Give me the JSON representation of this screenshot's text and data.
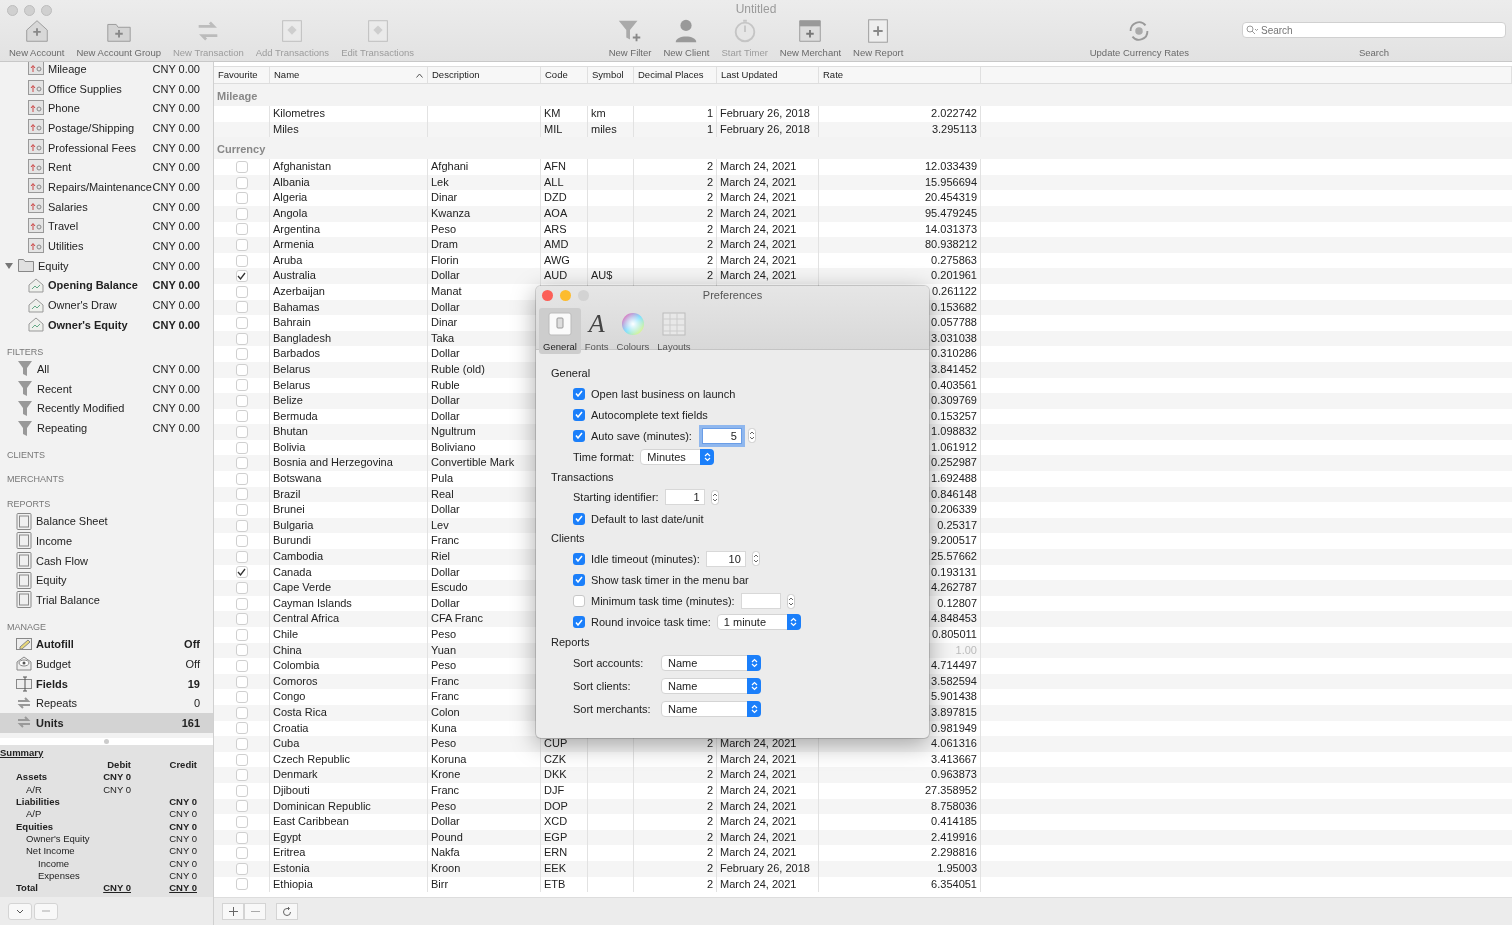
{
  "window": {
    "title": "Untitled"
  },
  "toolbar": {
    "items": [
      {
        "label": "New Account",
        "disabled": false
      },
      {
        "label": "New Account Group",
        "disabled": false
      },
      {
        "label": "New Transaction",
        "disabled": true
      },
      {
        "label": "Add Transactions",
        "disabled": true
      },
      {
        "label": "Edit Transactions",
        "disabled": true
      },
      {
        "label": "New Filter",
        "disabled": false
      },
      {
        "label": "New Client",
        "disabled": false
      },
      {
        "label": "Start Timer",
        "disabled": true
      },
      {
        "label": "New Merchant",
        "disabled": false
      },
      {
        "label": "New Report",
        "disabled": false
      },
      {
        "label": "Update Currency Rates",
        "disabled": false
      }
    ],
    "search": {
      "placeholder": "Search",
      "label": "Search"
    }
  },
  "sidebar": {
    "accounts": [
      {
        "name": "Mileage",
        "amount": "CNY 0.00",
        "emphasized": false
      },
      {
        "name": "Office Supplies",
        "amount": "CNY 0.00",
        "emphasized": false
      },
      {
        "name": "Phone",
        "amount": "CNY 0.00",
        "emphasized": false
      },
      {
        "name": "Postage/Shipping",
        "amount": "CNY 0.00",
        "emphasized": false
      },
      {
        "name": "Professional Fees",
        "amount": "CNY 0.00",
        "emphasized": false
      },
      {
        "name": "Rent",
        "amount": "CNY 0.00",
        "emphasized": false
      },
      {
        "name": "Repairs/Maintenance",
        "amount": "CNY 0.00",
        "emphasized": false
      },
      {
        "name": "Salaries",
        "amount": "CNY 0.00",
        "emphasized": false
      },
      {
        "name": "Travel",
        "amount": "CNY 0.00",
        "emphasized": false
      },
      {
        "name": "Utilities",
        "amount": "CNY 0.00",
        "emphasized": false
      },
      {
        "name": "Equity",
        "amount": "CNY 0.00",
        "emphasized": false,
        "expanded": true,
        "children": [
          {
            "name": "Opening Balance",
            "amount": "CNY 0.00",
            "emphasized": true
          },
          {
            "name": "Owner's Draw",
            "amount": "CNY 0.00",
            "emphasized": false
          },
          {
            "name": "Owner's Equity",
            "amount": "CNY 0.00",
            "emphasized": true
          }
        ]
      }
    ],
    "sections": [
      {
        "heading": "FILTERS",
        "kind": "filters",
        "items": [
          {
            "name": "All",
            "value": "CNY 0.00",
            "emphasized": false,
            "selected": false
          },
          {
            "name": "Recent",
            "value": "CNY 0.00",
            "emphasized": false,
            "selected": false
          },
          {
            "name": "Recently Modified",
            "value": "CNY 0.00",
            "emphasized": false,
            "selected": false
          },
          {
            "name": "Repeating",
            "value": "CNY 0.00",
            "emphasized": false,
            "selected": false
          }
        ]
      },
      {
        "heading": "CLIENTS",
        "kind": "clients"
      },
      {
        "heading": "MERCHANTS",
        "kind": "merchants"
      },
      {
        "heading": "REPORTS",
        "kind": "reports",
        "items": [
          {
            "name": "Balance Sheet",
            "emphasized": false,
            "selected": false
          },
          {
            "name": "Income",
            "emphasized": false,
            "selected": false
          },
          {
            "name": "Cash Flow",
            "emphasized": false,
            "selected": false
          },
          {
            "name": "Equity",
            "emphasized": false,
            "selected": false
          },
          {
            "name": "Trial Balance",
            "emphasized": false,
            "selected": false
          }
        ]
      },
      {
        "heading": "MANAGE",
        "kind": "manage",
        "items": [
          {
            "name": "Autofill",
            "value": "Off",
            "emphasized": true,
            "selected": false
          },
          {
            "name": "Budget",
            "value": "Off",
            "emphasized": false,
            "selected": false
          },
          {
            "name": "Fields",
            "value": "19",
            "emphasized": true,
            "selected": false
          },
          {
            "name": "Repeats",
            "value": "0",
            "emphasized": false,
            "selected": false
          },
          {
            "name": "Units",
            "value": "161",
            "emphasized": true,
            "selected": true
          }
        ]
      }
    ],
    "summary": {
      "title": "Summary",
      "debit_heading": "Debit",
      "credit_heading": "Credit",
      "rows": [
        {
          "label": "Assets",
          "kind": "group",
          "debit": "CNY 0",
          "children": [
            {
              "label": "A/R",
              "debit": "CNY 0"
            }
          ]
        },
        {
          "label": "Liabilities",
          "kind": "group",
          "credit": "CNY 0",
          "children": [
            {
              "label": "A/P",
              "credit": "CNY 0"
            }
          ]
        },
        {
          "label": "Equities",
          "kind": "group",
          "credit": "CNY 0",
          "children": [
            {
              "label": "Owner's Equity",
              "credit": "CNY 0"
            },
            {
              "label": "Net Income",
              "credit": "CNY 0",
              "children": [
                {
                  "label": "Income",
                  "credit": "CNY 0"
                },
                {
                  "label": "Expenses",
                  "credit": "CNY 0"
                }
              ]
            }
          ]
        },
        {
          "label": "Total",
          "kind": "total",
          "debit": "CNY 0",
          "credit": "CNY 0"
        }
      ]
    }
  },
  "table": {
    "columns": [
      {
        "label": "Favourite",
        "sorted": false
      },
      {
        "label": "Name",
        "sorted": true
      },
      {
        "label": "Description",
        "sorted": false
      },
      {
        "label": "Code",
        "sorted": false
      },
      {
        "label": "Symbol",
        "sorted": false
      },
      {
        "label": "Decimal Places",
        "sorted": false
      },
      {
        "label": "Last Updated",
        "sorted": false
      },
      {
        "label": "Rate",
        "sorted": false
      }
    ],
    "groups": [
      {
        "name": "Mileage",
        "kind": "mileage",
        "rows": [
          {
            "name": "Kilometres",
            "code": "KM",
            "symbol": "km",
            "decimals": "1",
            "updated": "February 26, 2018",
            "rate": "2.022742"
          },
          {
            "name": "Miles",
            "code": "MIL",
            "symbol": "miles",
            "decimals": "1",
            "updated": "February 26, 2018",
            "rate": "3.295113"
          }
        ]
      },
      {
        "name": "Currency",
        "kind": "currency",
        "rows": [
          {
            "favourite": false,
            "name": "Afghanistan",
            "description": "Afghani",
            "code": "AFN",
            "decimals": "2",
            "updated": "March 24, 2021",
            "rate": "12.033439"
          },
          {
            "favourite": false,
            "name": "Albania",
            "description": "Lek",
            "code": "ALL",
            "decimals": "2",
            "updated": "March 24, 2021",
            "rate": "15.956694"
          },
          {
            "favourite": false,
            "name": "Algeria",
            "description": "Dinar",
            "code": "DZD",
            "decimals": "2",
            "updated": "March 24, 2021",
            "rate": "20.454319"
          },
          {
            "favourite": false,
            "name": "Angola",
            "description": "Kwanza",
            "code": "AOA",
            "decimals": "2",
            "updated": "March 24, 2021",
            "rate": "95.479245"
          },
          {
            "favourite": false,
            "name": "Argentina",
            "description": "Peso",
            "code": "ARS",
            "decimals": "2",
            "updated": "March 24, 2021",
            "rate": "14.031373"
          },
          {
            "favourite": false,
            "name": "Armenia",
            "description": "Dram",
            "code": "AMD",
            "decimals": "2",
            "updated": "March 24, 2021",
            "rate": "80.938212"
          },
          {
            "favourite": false,
            "name": "Aruba",
            "description": "Florin",
            "code": "AWG",
            "decimals": "2",
            "updated": "March 24, 2021",
            "rate": "0.275863"
          },
          {
            "favourite": true,
            "name": "Australia",
            "description": "Dollar",
            "code": "AUD",
            "symbol": "AU$",
            "decimals": "2",
            "updated": "March 24, 2021",
            "rate": "0.201961"
          },
          {
            "favourite": false,
            "name": "Azerbaijan",
            "description": "Manat",
            "rate": "0.261122"
          },
          {
            "favourite": false,
            "name": "Bahamas",
            "description": "Dollar",
            "rate": "0.153682"
          },
          {
            "favourite": false,
            "name": "Bahrain",
            "description": "Dinar",
            "rate": "0.057788"
          },
          {
            "favourite": false,
            "name": "Bangladesh",
            "description": "Taka",
            "rate": "3.031038"
          },
          {
            "favourite": false,
            "name": "Barbados",
            "description": "Dollar",
            "rate": "0.310286"
          },
          {
            "favourite": false,
            "name": "Belarus",
            "description": "Ruble (old)",
            "rate": "3.841452"
          },
          {
            "favourite": false,
            "name": "Belarus",
            "description": "Ruble",
            "rate": "0.403561"
          },
          {
            "favourite": false,
            "name": "Belize",
            "description": "Dollar",
            "rate": "0.309769"
          },
          {
            "favourite": false,
            "name": "Bermuda",
            "description": "Dollar",
            "rate": "0.153257"
          },
          {
            "favourite": false,
            "name": "Bhutan",
            "description": "Ngultrum",
            "rate": "1.098832"
          },
          {
            "favourite": false,
            "name": "Bolivia",
            "description": "Boliviano",
            "rate": "1.061912"
          },
          {
            "favourite": false,
            "name": "Bosnia and Herzegovina",
            "description": "Convertible Mark",
            "rate": "0.252987"
          },
          {
            "favourite": false,
            "name": "Botswana",
            "description": "Pula",
            "rate": "1.692488"
          },
          {
            "favourite": false,
            "name": "Brazil",
            "description": "Real",
            "rate": "0.846148"
          },
          {
            "favourite": false,
            "name": "Brunei",
            "description": "Dollar",
            "rate": "0.206339"
          },
          {
            "favourite": false,
            "name": "Bulgaria",
            "description": "Lev",
            "rate": "0.25317"
          },
          {
            "favourite": false,
            "name": "Burundi",
            "description": "Franc",
            "rate": "9.200517"
          },
          {
            "favourite": false,
            "name": "Cambodia",
            "description": "Riel",
            "rate": "25.57662"
          },
          {
            "favourite": true,
            "name": "Canada",
            "description": "Dollar",
            "rate": "0.193131"
          },
          {
            "favourite": false,
            "name": "Cape Verde",
            "description": "Escudo",
            "rate": "4.262787"
          },
          {
            "favourite": false,
            "name": "Cayman Islands",
            "description": "Dollar",
            "rate": "0.12807"
          },
          {
            "favourite": false,
            "name": "Central Africa",
            "description": "CFA Franc",
            "rate": "4.848453"
          },
          {
            "favourite": false,
            "name": "Chile",
            "description": "Peso",
            "rate": "0.805011"
          },
          {
            "favourite": false,
            "name": "China",
            "description": "Yuan",
            "rate": "1.00",
            "rate_dimmed": true
          },
          {
            "favourite": false,
            "name": "Colombia",
            "description": "Peso",
            "rate": "4.714497"
          },
          {
            "favourite": false,
            "name": "Comoros",
            "description": "Franc",
            "rate": "3.582594"
          },
          {
            "favourite": false,
            "name": "Congo",
            "description": "Franc",
            "rate": "5.901438"
          },
          {
            "favourite": false,
            "name": "Costa Rica",
            "description": "Colon",
            "rate": "3.897815"
          },
          {
            "favourite": false,
            "name": "Croatia",
            "description": "Kuna",
            "rate": "0.981949"
          },
          {
            "favourite": false,
            "name": "Cuba",
            "description": "Peso",
            "code": "CUP",
            "decimals": "2",
            "updated": "March 24, 2021",
            "rate": "4.061316"
          },
          {
            "favourite": false,
            "name": "Czech Republic",
            "description": "Koruna",
            "code": "CZK",
            "decimals": "2",
            "updated": "March 24, 2021",
            "rate": "3.413667"
          },
          {
            "favourite": false,
            "name": "Denmark",
            "description": "Krone",
            "code": "DKK",
            "decimals": "2",
            "updated": "March 24, 2021",
            "rate": "0.963873"
          },
          {
            "favourite": false,
            "name": "Djibouti",
            "description": "Franc",
            "code": "DJF",
            "decimals": "2",
            "updated": "March 24, 2021",
            "rate": "27.358952"
          },
          {
            "favourite": false,
            "name": "Dominican Republic",
            "description": "Peso",
            "code": "DOP",
            "decimals": "2",
            "updated": "March 24, 2021",
            "rate": "8.758036"
          },
          {
            "favourite": false,
            "name": "East Caribbean",
            "description": "Dollar",
            "code": "XCD",
            "decimals": "2",
            "updated": "March 24, 2021",
            "rate": "0.414185"
          },
          {
            "favourite": false,
            "name": "Egypt",
            "description": "Pound",
            "code": "EGP",
            "decimals": "2",
            "updated": "March 24, 2021",
            "rate": "2.419916"
          },
          {
            "favourite": false,
            "name": "Eritrea",
            "description": "Nakfa",
            "code": "ERN",
            "decimals": "2",
            "updated": "March 24, 2021",
            "rate": "2.298816"
          },
          {
            "favourite": false,
            "name": "Estonia",
            "description": "Kroon",
            "code": "EEK",
            "decimals": "2",
            "updated": "February 26, 2018",
            "rate": "1.95003"
          },
          {
            "favourite": false,
            "name": "Ethiopia",
            "description": "Birr",
            "code": "ETB",
            "decimals": "2",
            "updated": "March 24, 2021",
            "rate": "6.354051"
          }
        ]
      }
    ]
  },
  "preferences": {
    "title": "Preferences",
    "tabs": [
      {
        "label": "General",
        "selected": true
      },
      {
        "label": "Fonts",
        "selected": false,
        "glyph": "A"
      },
      {
        "label": "Colours",
        "selected": false
      },
      {
        "label": "Layouts",
        "selected": false
      }
    ],
    "sections": [
      {
        "heading": "General",
        "rows": [
          {
            "kind": "check",
            "label": "Open last business on launch",
            "checked": true
          },
          {
            "kind": "check",
            "label": "Autocomplete text fields",
            "checked": true
          },
          {
            "kind": "check-stepper",
            "label": "Auto save (minutes):",
            "checked": true,
            "value": "5",
            "focused": true
          },
          {
            "kind": "select",
            "label": "Time format:",
            "value": "Minutes"
          }
        ]
      },
      {
        "heading": "Transactions",
        "rows": [
          {
            "kind": "stepper",
            "label": "Starting identifier:",
            "value": "1"
          },
          {
            "kind": "check",
            "label": "Default to last date/unit",
            "checked": true
          }
        ]
      },
      {
        "heading": "Clients",
        "rows": [
          {
            "kind": "check-stepper",
            "label": "Idle timeout (minutes):",
            "checked": true,
            "value": "10"
          },
          {
            "kind": "check",
            "label": "Show task timer in the menu bar",
            "checked": true
          },
          {
            "kind": "check-stepper",
            "label": "Minimum task time (minutes):",
            "checked": false
          },
          {
            "kind": "check-select",
            "label": "Round invoice task time:",
            "checked": true,
            "value": "1 minute"
          }
        ]
      },
      {
        "heading": "Reports",
        "rows": [
          {
            "kind": "select",
            "label": "Sort accounts:",
            "value": "Name"
          },
          {
            "kind": "select",
            "label": "Sort clients:",
            "value": "Name"
          },
          {
            "kind": "select",
            "label": "Sort merchants:",
            "value": "Name"
          }
        ]
      }
    ]
  }
}
